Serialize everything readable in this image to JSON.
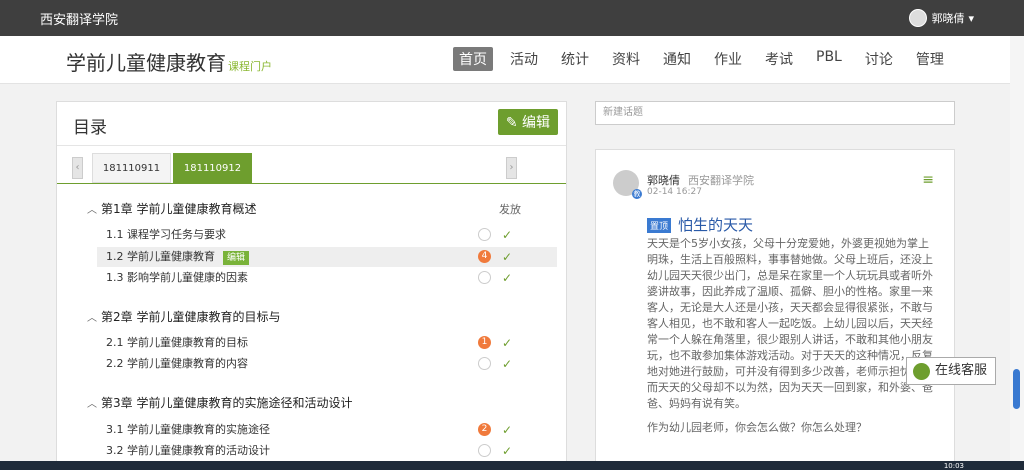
{
  "topbar": {
    "brand": "西安翻译学院",
    "user": "郭晓倩"
  },
  "navbar": {
    "title": "学前儿童健康教育",
    "subtitle": "课程门户",
    "items": [
      "首页",
      "活动",
      "统计",
      "资料",
      "通知",
      "作业",
      "考试",
      "PBL",
      "讨论",
      "管理"
    ]
  },
  "catalog": {
    "title": "目录",
    "edit_label": "编辑",
    "tabs": [
      "181110911",
      "181110912"
    ],
    "fa_label": "发放",
    "chapters": [
      {
        "title": "第1章 学前儿童健康教育概述",
        "sections": [
          "1.1 课程学习任务与要求",
          "1.2 学前儿童健康教育",
          "1.3 影响学前儿童健康的因素"
        ]
      },
      {
        "title": "第2章 学前儿童健康教育的目标与",
        "sections": [
          "2.1 学前儿童健康教育的目标",
          "2.2 学前儿童健康教育的内容"
        ]
      },
      {
        "title": "第3章 学前儿童健康教育的实施途径和活动设计",
        "sections": [
          "3.1 学前儿童健康教育的实施途径",
          "3.2 学前儿童健康教育的活动设计"
        ]
      }
    ],
    "row_badge": "编辑",
    "dots": [
      "4",
      "1",
      "2"
    ]
  },
  "newtopic": {
    "placeholder": "新建话题"
  },
  "post": {
    "author": "郭晓倩",
    "org": "西安翻译学院",
    "time": "02-14 16:27",
    "pin": "置顶",
    "title": "怕生的天天",
    "body": "天天是个5岁小女孩，父母十分宠爱她，外婆更视她为掌上明珠，生活上百般照料，事事替她做。父母上班后，还没上幼儿园天天很少出门，总是呆在家里一个人玩玩具或者听外婆讲故事，因此养成了温顺、孤僻、胆小的性格。家里一来客人，无论是大人还是小孩，天天都会显得很紧张，不敢与客人相见，也不敢和客人一起吃饭。上幼儿园以后，天天经常一个人躲在角落里，很少跟别人讲话，不敢和其他小朋友玩，也不敢参加集体游戏活动。对于天天的这种情况，反复地对她进行鼓励，可并没有得到多少改善，老师示担忧。然而天天的父母却不以为然，因为天天一回到家，和外婆、爸爸、妈妈有说有笑。",
    "question": "作为幼儿园老师，你会怎么做？你怎么处理？",
    "verify": "教"
  },
  "kefu": {
    "label": "在线客服"
  },
  "taskbar": {
    "clock": "10:03"
  }
}
